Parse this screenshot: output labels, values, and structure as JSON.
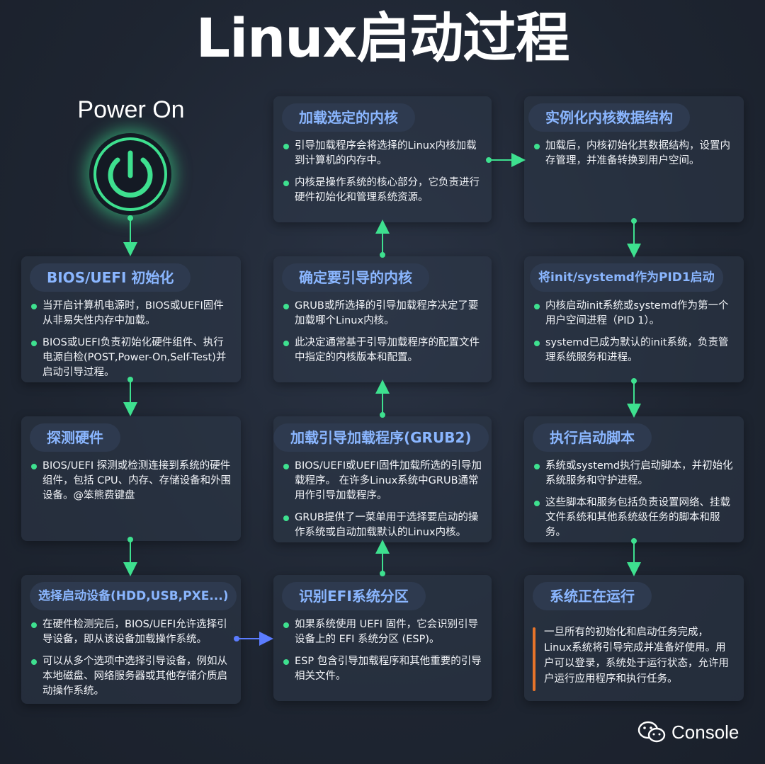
{
  "title": "Linux启动过程",
  "power_label": "Power On",
  "brand": "Console",
  "colors": {
    "accent_green": "#3ee08f",
    "title_blue": "#8ab6ff",
    "arrow_blue": "#5b7cff",
    "final_bar": "#e8742a"
  },
  "cards": {
    "bios_init": {
      "title": "BIOS/UEFI 初始化",
      "items": [
        "当开启计算机电源时，BIOS或UEFI固件从非易失性内存中加载。",
        "BIOS或UEFI负责初始化硬件组件、执行电源自检(POST,Power-On,Self-Test)并启动引导过程。"
      ]
    },
    "detect_hw": {
      "title": "探测硬件",
      "items": [
        "BIOS/UEFI 探测或检测连接到系统的硬件组件，包括 CPU、内存、存储设备和外围设备。@笨熊费键盘"
      ]
    },
    "select_boot": {
      "title": "选择启动设备(HDD,USB,PXE...)",
      "items": [
        "在硬件检测完后，BIOS/UEFI允许选择引导设备，即从该设备加载操作系统。",
        "可以从多个选项中选择引导设备，例如从本地磁盘、网络服务器或其他存储介质启动操作系统。"
      ]
    },
    "efi_part": {
      "title": "识别EFI系统分区",
      "items": [
        "如果系统使用 UEFI 固件，它会识别引导设备上的 EFI 系统分区 (ESP)。",
        "ESP 包含引导加载程序和其他重要的引导相关文件。"
      ]
    },
    "load_grub": {
      "title": "加载引导加载程序(GRUB2)",
      "items": [
        "BIOS/UEFI或UEFI固件加载所选的引导加载程序。 在许多Linux系统中GRUB通常用作引导加载程序。",
        "GRUB提供了一菜单用于选择要启动的操作系统或自动加载默认的Linux内核。"
      ]
    },
    "decide_kernel": {
      "title": "确定要引导的内核",
      "items": [
        "GRUB或所选择的引导加载程序决定了要加载哪个Linux内核。",
        "此决定通常基于引导加载程序的配置文件中指定的内核版本和配置。"
      ]
    },
    "load_kernel": {
      "title": "加载选定的内核",
      "items": [
        "引导加载程序会将选择的Linux内核加载到计算机的内存中。",
        "内核是操作系统的核心部分，它负责进行硬件初始化和管理系统资源。"
      ]
    },
    "kernel_struct": {
      "title": "实例化内核数据结构",
      "items": [
        "加载后，内核初始化其数据结构，设置内存管理，并准备转换到用户空间。"
      ]
    },
    "init_pid1": {
      "title": "将init/systemd作为PID1启动",
      "items": [
        "内核启动init系统或systemd作为第一个用户空间进程（PID 1）。",
        "systemd已成为默认的init系统，负责管理系统服务和进程。"
      ]
    },
    "run_scripts": {
      "title": "执行启动脚本",
      "items": [
        "系统或systemd执行启动脚本，并初始化系统服务和守护进程。",
        "这些脚本和服务包括负责设置网络、挂载文件系统和其他系统级任务的脚本和服务。"
      ]
    },
    "running": {
      "title": "系统正在运行",
      "text": "一旦所有的初始化和启动任务完成，Linux系统将引导完成并准备好使用。用户可以登录，系统处于运行状态，允许用户运行应用程序和执行任务。"
    }
  }
}
